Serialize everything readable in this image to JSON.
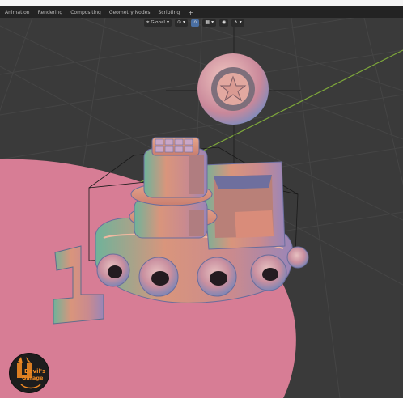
{
  "workspace_tabs": [
    {
      "label": "Animation"
    },
    {
      "label": "Rendering"
    },
    {
      "label": "Compositing"
    },
    {
      "label": "Geometry Nodes"
    },
    {
      "label": "Scripting"
    }
  ],
  "add_tab_label": "+",
  "viewport_header": {
    "orientation_label": "Global",
    "transform_icon": "transform-orientation-icon",
    "pivot_icon": "pivot-icon",
    "snap_icon": "snap-magnet-icon",
    "proportional_icon": "proportional-edit-icon",
    "chevron": "▾"
  },
  "logo": {
    "line1": "Devil's",
    "line2": "Garage"
  },
  "colors": {
    "viewport_bg": "#3a3a3a",
    "grid_line": "#444444",
    "floor_pink": "#d97a94",
    "y_axis": "#8fbf3a",
    "logo_orange": "#f08a24",
    "tabs_bg": "#232323"
  }
}
